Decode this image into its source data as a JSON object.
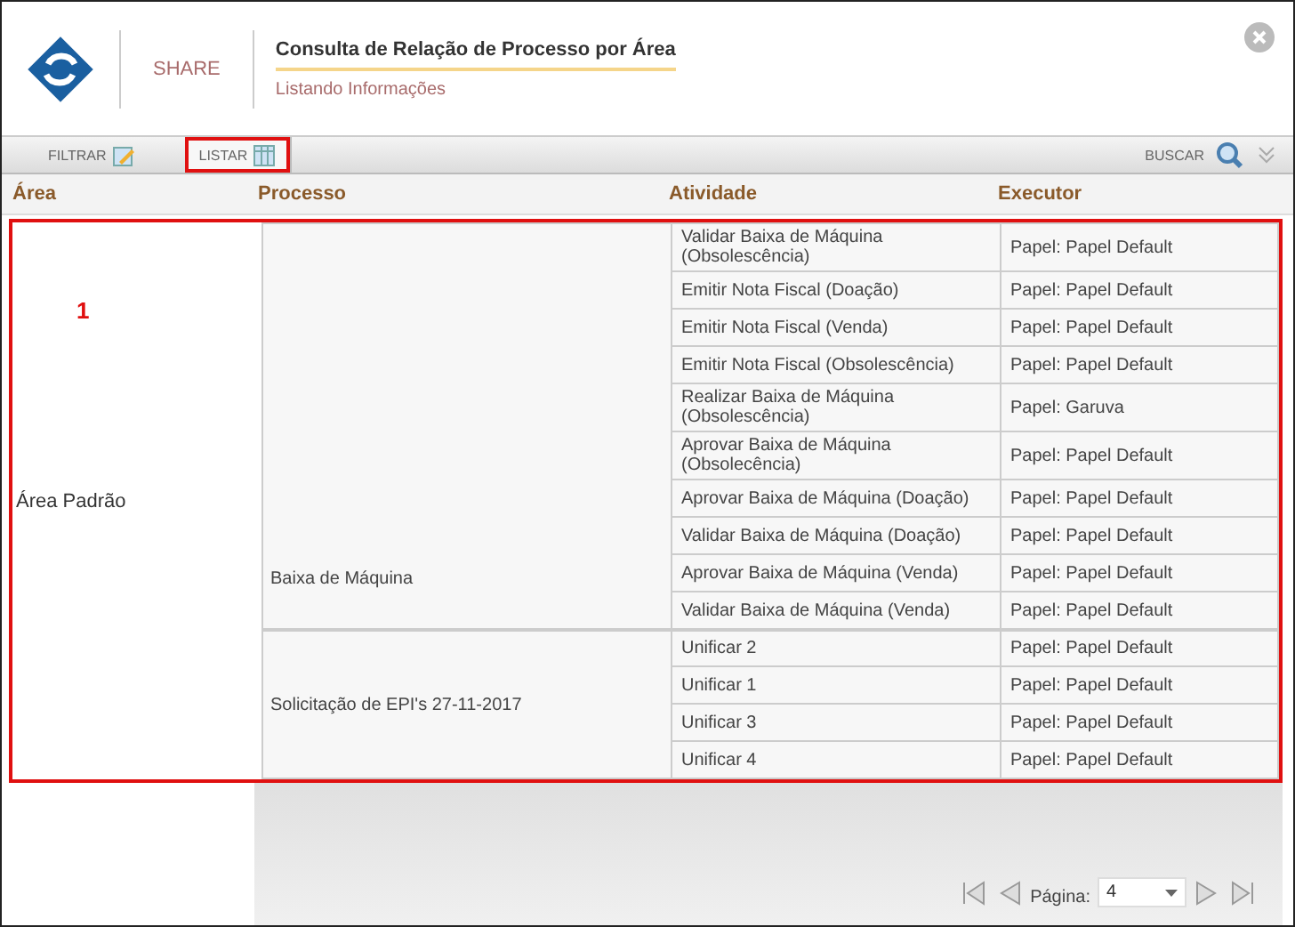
{
  "window": {
    "brand": "SHARE",
    "title": "Consulta de Relação de Processo por Área",
    "subtitle": "Listando Informações"
  },
  "toolbar": {
    "tabs": [
      {
        "label": "FILTRAR",
        "selected": false,
        "highlighted": false
      },
      {
        "label": "LISTAR",
        "selected": true,
        "highlighted": true
      }
    ],
    "search_label": "BUSCAR"
  },
  "table": {
    "columns": [
      "Área",
      "Processo",
      "Atividade",
      "Executor"
    ],
    "highlighted": true,
    "callout": "1",
    "areas": [
      {
        "name": "Área Padrão",
        "processes": [
          {
            "name": "Baixa de Máquina",
            "activities": [
              {
                "name": "Validar Baixa de Máquina (Obsolescência)",
                "executor": "Papel: Papel Default"
              },
              {
                "name": "Emitir Nota Fiscal (Doação)",
                "executor": "Papel: Papel Default"
              },
              {
                "name": "Emitir Nota Fiscal (Venda)",
                "executor": "Papel: Papel Default"
              },
              {
                "name": "Emitir Nota Fiscal (Obsolescência)",
                "executor": "Papel: Papel Default"
              },
              {
                "name": "Realizar Baixa de Máquina (Obsolescência)",
                "executor": "Papel: Garuva"
              },
              {
                "name": "Aprovar Baixa de Máquina (Obsolecência)",
                "executor": "Papel: Papel Default"
              },
              {
                "name": "Aprovar Baixa de Máquina (Doação)",
                "executor": "Papel: Papel Default"
              },
              {
                "name": "Validar Baixa de Máquina (Doação)",
                "executor": "Papel: Papel Default"
              },
              {
                "name": "Aprovar Baixa de Máquina (Venda)",
                "executor": "Papel: Papel Default"
              },
              {
                "name": "Validar Baixa de Máquina (Venda)",
                "executor": "Papel: Papel Default"
              }
            ]
          },
          {
            "name": "Solicitação de EPI's 27-11-2017",
            "activities": [
              {
                "name": "Unificar 2",
                "executor": "Papel: Papel Default"
              },
              {
                "name": "Unificar 1",
                "executor": "Papel: Papel Default"
              },
              {
                "name": "Unificar 3",
                "executor": "Papel: Papel Default"
              },
              {
                "name": "Unificar 4",
                "executor": "Papel: Papel Default"
              }
            ]
          }
        ]
      }
    ]
  },
  "pagination": {
    "label": "Página:",
    "page": "4"
  }
}
